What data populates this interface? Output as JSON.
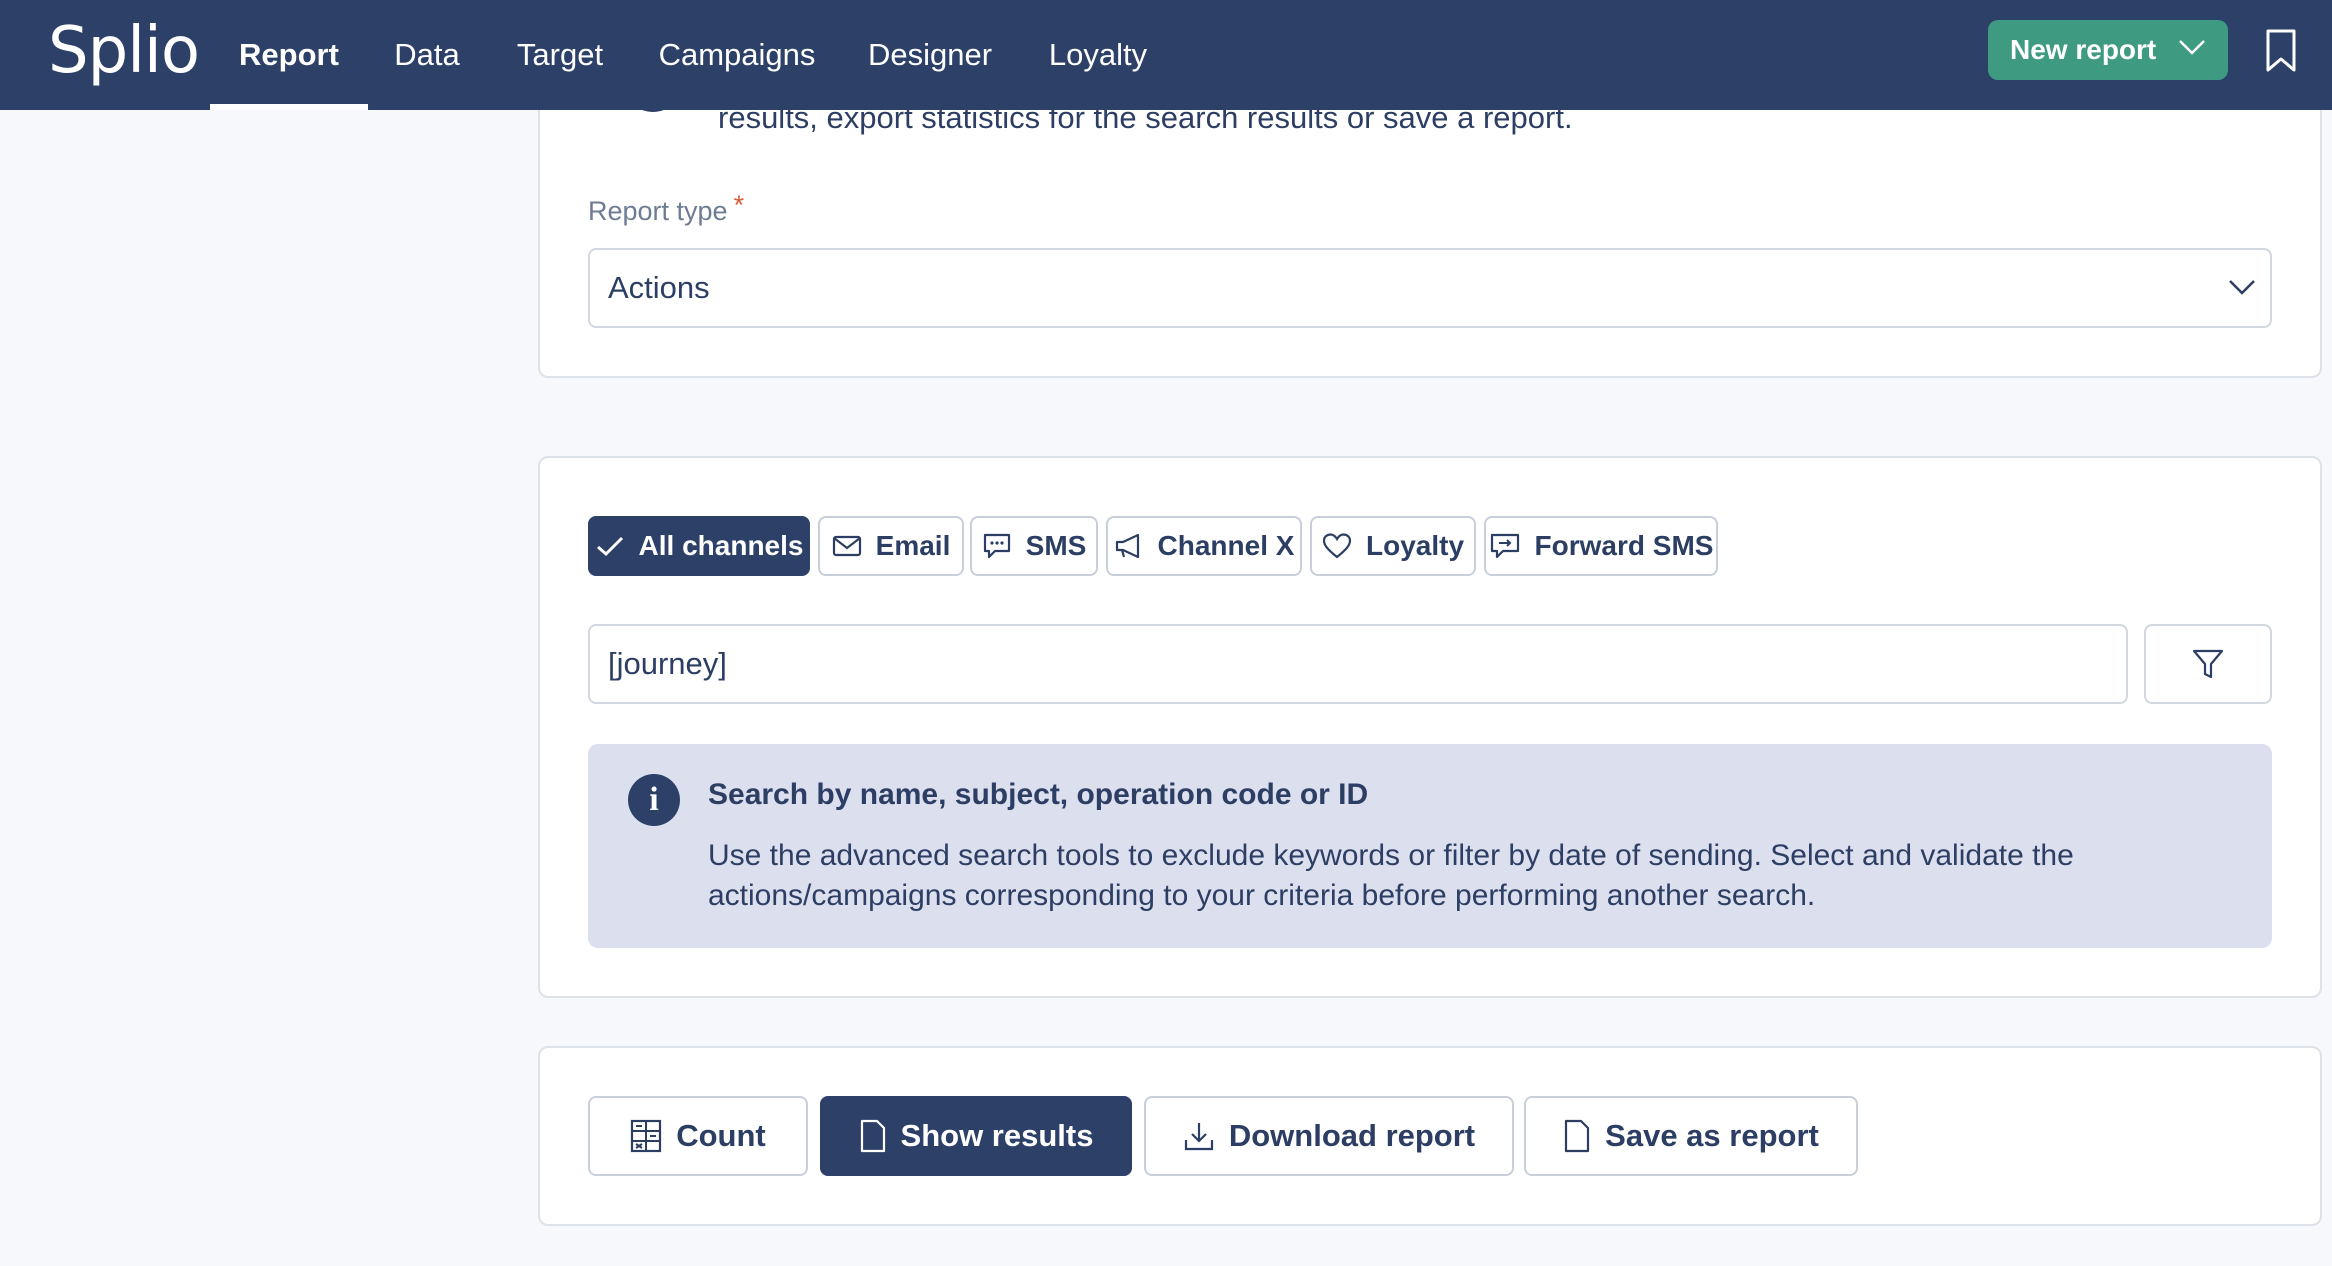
{
  "header": {
    "logo": "Splio",
    "nav": [
      {
        "label": "Report",
        "active": true
      },
      {
        "label": "Data"
      },
      {
        "label": "Target"
      },
      {
        "label": "Campaigns"
      },
      {
        "label": "Designer"
      },
      {
        "label": "Loyalty"
      }
    ],
    "new_report_label": "New report",
    "bookmark_icon": "bookmark-icon"
  },
  "report_type_panel": {
    "intro_text": "results, export statistics for the search results or save a report.",
    "label": "Report type",
    "required_mark": "*",
    "selected_value": "Actions"
  },
  "channels": {
    "chips": [
      {
        "label": "All channels",
        "icon": "check-icon",
        "active": true
      },
      {
        "label": "Email",
        "icon": "envelope-icon"
      },
      {
        "label": "SMS",
        "icon": "chat-bubble-icon"
      },
      {
        "label": "Channel X",
        "icon": "megaphone-icon"
      },
      {
        "label": "Loyalty",
        "icon": "heart-icon"
      },
      {
        "label": "Forward SMS",
        "icon": "forward-sms-icon"
      }
    ],
    "search_value": "[journey]",
    "filter_icon": "filter-icon"
  },
  "info": {
    "title": "Search by name, subject, operation code or ID",
    "body": "Use the advanced search tools to exclude keywords or filter by date of sending. Select and validate the actions/campaigns corresponding to your criteria before performing another search."
  },
  "actions": {
    "count": "Count",
    "show_results": "Show results",
    "download_report": "Download report",
    "save_as_report": "Save as report"
  },
  "colors": {
    "topbar": "#2d4068",
    "accent_green": "#3e9b82",
    "info_bg": "#dcdfee",
    "required": "#e05a3a"
  }
}
